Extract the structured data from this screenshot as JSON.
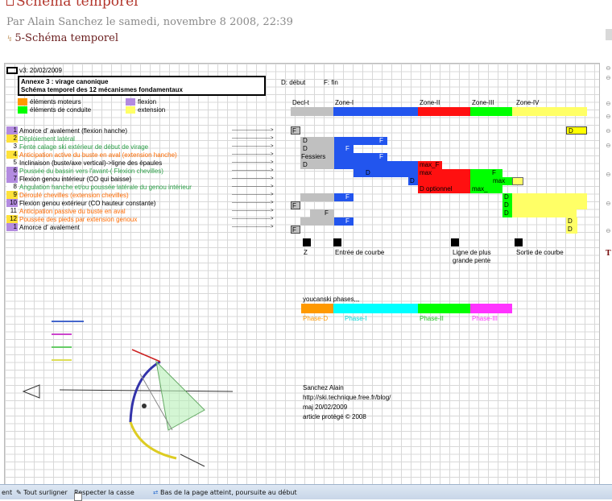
{
  "post": {
    "title": "Schéma temporel",
    "meta": "Par Alain Sanchez le samedi, novembre 8 2008, 22:39",
    "attachment_link": "5-Schéma temporel"
  },
  "sheet": {
    "version": "v3: 20/02/2009",
    "annex_title": "Annexe 3 : virage canonique",
    "subtitle": "Schéma temporel des 12 mécanismes fondamentaux",
    "legend": {
      "moteurs": "éléments moteurs",
      "conduite": "éléments de conduite",
      "flexion": "flexion",
      "extension": "extension"
    },
    "key": {
      "debut": "D: début",
      "fin": "F: fin"
    },
    "zones": [
      "Decl-t",
      "Zone-I",
      "Zone-II",
      "Zone-III",
      "Zone-IV"
    ],
    "arrow": "------------------------>",
    "rows": [
      {
        "num": "1",
        "label": "Amorce d' avalement (flexion hanche)",
        "color": "#000000",
        "badge": "#b38be0"
      },
      {
        "num": "2",
        "label": "Déploiement latéral",
        "color": "#2ca048",
        "badge": "#ffe23a"
      },
      {
        "num": "3",
        "label": "Fente calage ski extérieur de début de virage",
        "color": "#2ca048",
        "badge": "#ffffff"
      },
      {
        "num": "4",
        "label": "Anticipation active du buste en aval (extension hanche)",
        "color": "#ff6a00",
        "badge": "#ffe23a"
      },
      {
        "num": "5",
        "label": "Inclinaison (buste/axe vertical)->ligne des épaules",
        "color": "#000000",
        "badge": "#ffffff"
      },
      {
        "num": "6",
        "label": "Poussée du bassin vers l'avant-( Flexion chevilles)",
        "color": "#2ca048",
        "badge": "#b38be0"
      },
      {
        "num": "7",
        "label": "Flexion genou intérieur (CO qui baisse)",
        "color": "#000000",
        "badge": "#b38be0"
      },
      {
        "num": "8",
        "label": "Angulation hanche et/ou poussée latérale du genou intérieur",
        "color": "#2ca048",
        "badge": "#ffffff"
      },
      {
        "num": "9",
        "label": "Déroulé chevilles (extension chevilles)",
        "color": "#ff6a00",
        "badge": "#ffe23a"
      },
      {
        "num": "10",
        "label": "Flexion genou extérieur (CO hauteur constante)",
        "color": "#000000",
        "badge": "#b38be0"
      },
      {
        "num": "11",
        "label": "Anticipation passive du buste en aval",
        "color": "#ff6a00",
        "badge": "#ffffff"
      },
      {
        "num": "12",
        "label": "Poussée des pieds par extension genoux",
        "color": "#ff6a00",
        "badge": "#ffe23a"
      },
      {
        "num": "1",
        "label": "Amorce d' avalement",
        "color": "#000000",
        "badge": "#b38be0"
      }
    ],
    "cells": {
      "F": "F",
      "D": "D",
      "fessiers": "Fessiers",
      "max_f": "max_F",
      "max": "max",
      "d_optionnel": "D optionnel",
      "max_short": "max_"
    },
    "markers": {
      "z": "Z",
      "entree": "Entrée de courbe",
      "ligne1": "Ligne de plus",
      "ligne2": "grande pente",
      "sortie": "Sortie de courbe"
    },
    "youcanski": {
      "title": "youcanski phases,,,",
      "phases": [
        "Phase-D",
        "Phase-I",
        "Phase-II",
        "Phase-III"
      ]
    },
    "credit": {
      "author": "Sanchez Alain",
      "url": "http://ski.technique.free.fr/blog/",
      "date": "maj 20/02/2009",
      "rights": "article protégé © 2008"
    },
    "colors": {
      "orange": "#ff9900",
      "purple": "#b38be0",
      "green": "#00ff00",
      "yellow": "#ffff66",
      "gray": "#c0c0c0",
      "blue": "#2255ee",
      "red": "#ff1010",
      "cyan": "#00ffff",
      "magenta": "#ff33ff",
      "black": "#000000"
    }
  },
  "findbar": {
    "highlight_all": "Tout surligner",
    "match_case": "Respecter la casse",
    "status": "Bas de la page atteint, poursuite au début",
    "prefix": "ent"
  }
}
